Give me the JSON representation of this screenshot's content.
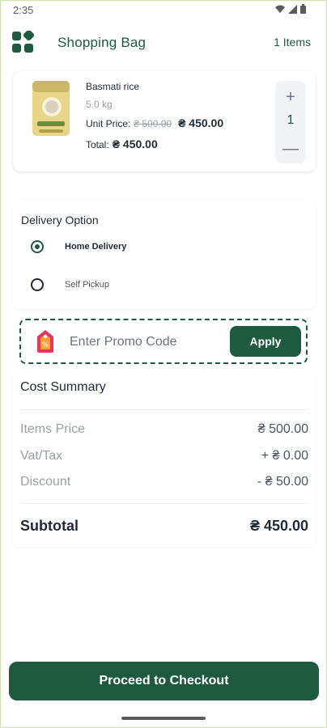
{
  "status_bar": {
    "time": "2:35"
  },
  "header": {
    "title": "Shopping Bag",
    "item_count": "1 Items"
  },
  "cart": {
    "items": [
      {
        "name": "Basmati rice",
        "weight": "5.0 kg",
        "unit_price_label": "Unit Price:",
        "unit_price_old": "₴ 500.00",
        "unit_price_new": "₴ 450.00",
        "total_label": "Total:",
        "total_value": "₴ 450.00",
        "quantity": "1",
        "plus_symbol": "+",
        "minus_symbol": "—"
      }
    ]
  },
  "delivery": {
    "title": "Delivery Option",
    "options": [
      {
        "label": "Home Delivery",
        "selected": true
      },
      {
        "label": "Self Pickup",
        "selected": false
      }
    ]
  },
  "promo": {
    "placeholder": "Enter Promo Code",
    "apply_label": "Apply"
  },
  "cost_summary": {
    "title": "Cost Summary",
    "rows": [
      {
        "label": "Items Price",
        "value": "₴ 500.00"
      },
      {
        "label": "Vat/Tax",
        "value": "+ ₴ 0.00"
      },
      {
        "label": "Discount",
        "value": "- ₴ 50.00"
      }
    ],
    "subtotal_label": "Subtotal",
    "subtotal_value": "₴ 450.00"
  },
  "checkout": {
    "label": "Proceed to Checkout"
  },
  "colors": {
    "brand": "#1e5a40",
    "muted": "#9aa0a6",
    "border": "#cfe3b0"
  }
}
